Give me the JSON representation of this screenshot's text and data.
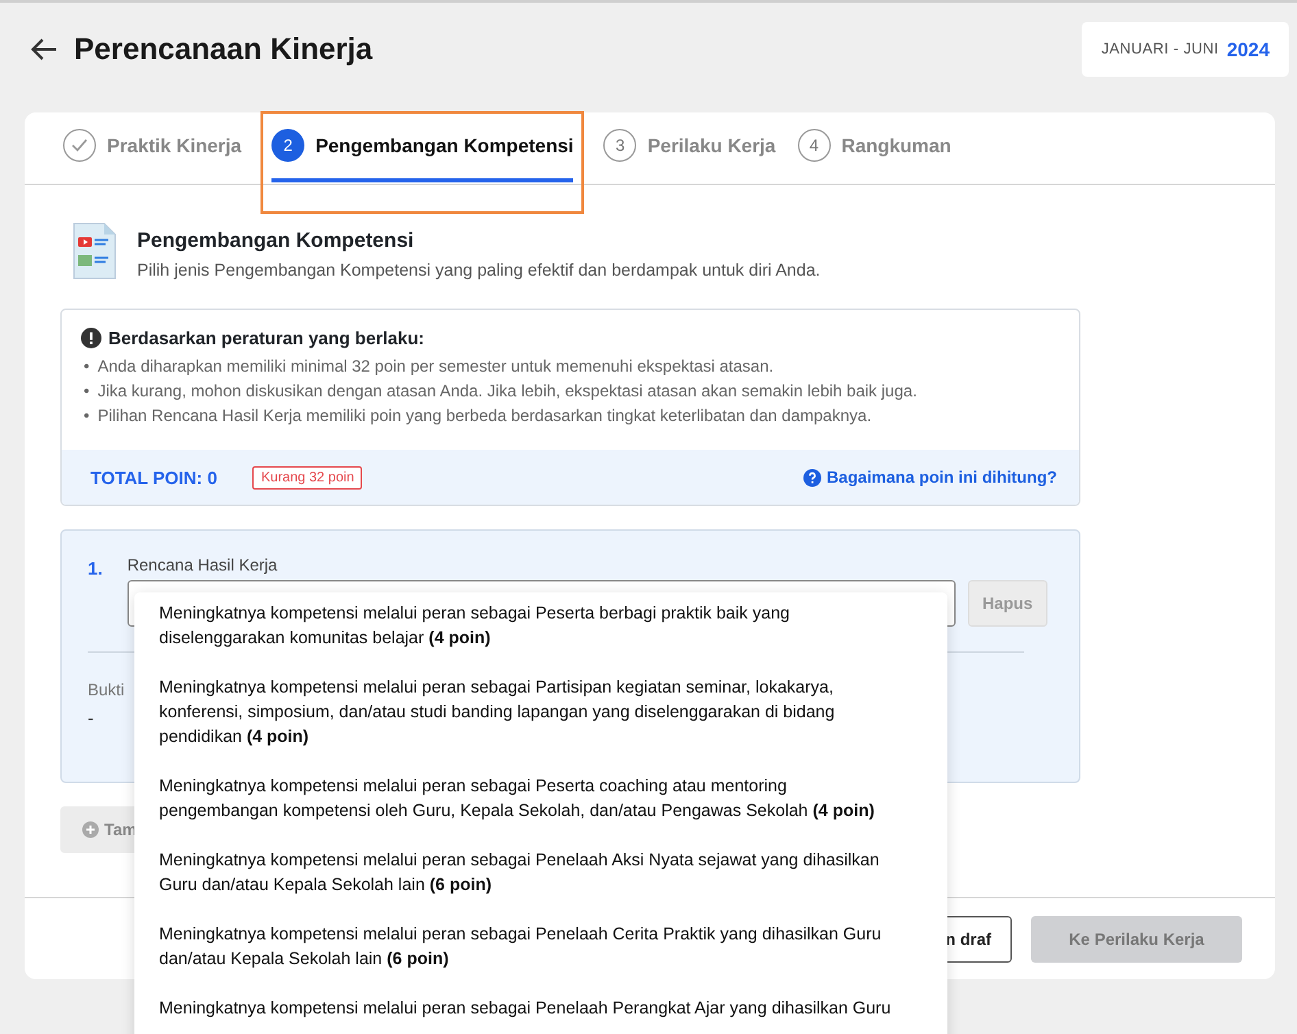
{
  "header": {
    "title": "Perencanaan Kinerja",
    "period_label": "JANUARI - JUNI",
    "period_year": "2024"
  },
  "steps": [
    {
      "label": "Praktik Kinerja",
      "done": true,
      "selected": false,
      "highlighted": false
    },
    {
      "marker": "2",
      "label": "Pengembangan Kompetensi",
      "done": false,
      "selected": true,
      "highlighted": true
    },
    {
      "marker": "3",
      "label": "Perilaku Kerja",
      "done": false,
      "selected": false,
      "highlighted": false
    },
    {
      "marker": "4",
      "label": "Rangkuman",
      "done": false,
      "selected": false,
      "highlighted": false
    }
  ],
  "section": {
    "title": "Pengembangan Kompetensi",
    "subtitle": "Pilih jenis Pengembangan Kompetensi yang paling efektif dan berdampak untuk diri Anda."
  },
  "info": {
    "title": "Berdasarkan peraturan yang berlaku:",
    "bullets": [
      {
        "marker": "•",
        "text": "Anda diharapkan memiliki minimal 32 poin per semester untuk memenuhi ekspektasi atasan."
      },
      {
        "marker": "•",
        "text": "Jika kurang, mohon diskusikan dengan atasan Anda. Jika lebih, ekspektasi atasan akan semakin lebih baik juga."
      },
      {
        "marker": "•",
        "text": "Pilihan Rencana Hasil Kerja memiliki poin yang berbeda berdasarkan tingkat keterlibatan dan dampaknya."
      }
    ],
    "total": "TOTAL POIN: 0",
    "badge": "Kurang 32 poin",
    "help_link": "Bagaimana poin ini dihitung?"
  },
  "item": {
    "number": "1.",
    "label": "Rencana Hasil Kerja",
    "delete_button": "Hapus",
    "delete_disabled": true,
    "evidence_label": "Bukti",
    "evidence_value": "-"
  },
  "add_button": "Tam",
  "footer": {
    "draft_button": "n draf",
    "next_button": "Ke Perilaku Kerja",
    "next_disabled": true
  },
  "dropdown": {
    "options": [
      "Meningkatnya kompetensi melalui peran sebagai Peserta berbagi praktik baik yang diselenggarakan komunitas belajar **(4 poin)**",
      "Meningkatnya kompetensi melalui peran sebagai Partisipan kegiatan seminar, lokakarya, konferensi, simposium, dan/atau studi banding lapangan yang diselenggarakan di bidang pendidikan **(4 poin)**",
      "Meningkatnya kompetensi melalui peran sebagai Peserta coaching atau mentoring pengembangan kompetensi oleh Guru, Kepala Sekolah, dan/atau Pengawas Sekolah **(4 poin)**",
      "Meningkatnya kompetensi melalui peran sebagai Penelaah Aksi Nyata sejawat yang dihasilkan Guru dan/atau Kepala Sekolah lain **(6 poin)**",
      "Meningkatnya kompetensi melalui peran sebagai Penelaah Cerita Praktik yang dihasilkan Guru dan/atau Kepala Sekolah lain **(6 poin)**",
      "Meningkatnya kompetensi melalui peran sebagai Penelaah Perangkat Ajar yang dihasilkan Guru"
    ]
  }
}
